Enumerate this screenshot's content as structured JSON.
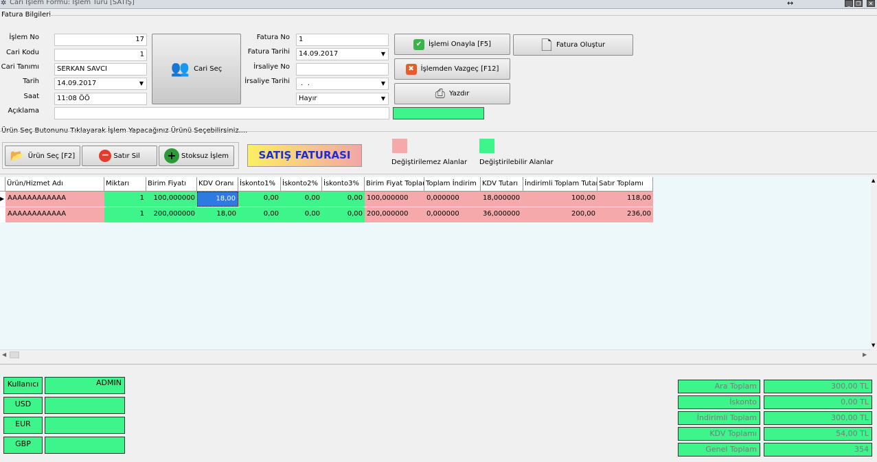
{
  "window": {
    "title": "Cari İşlem Formu: İşlem Türü [SATIŞ]"
  },
  "section": {
    "title": "Fatura Bilgileri",
    "hint": "Ürün Seç Butonunu Tıklayarak İşlem Yapacağınız Ürünü Seçebilirsiniz...."
  },
  "left_form": {
    "islem_no": {
      "label": "İşlem No",
      "value": "17"
    },
    "cari_kodu": {
      "label": "Cari Kodu",
      "value": "1"
    },
    "cari_tanimi": {
      "label": "Cari Tanımı",
      "value": "SERKAN SAVCI"
    },
    "tarih": {
      "label": "Tarih",
      "value": "14.09.2017"
    },
    "saat": {
      "label": "Saat",
      "value": "11:08 ÖÖ"
    },
    "aciklama": {
      "label": "Açıklama",
      "value": ""
    }
  },
  "cari_sec_button": "Cari Seç",
  "mid_form": {
    "fatura_no": {
      "label": "Fatura No",
      "value": "1"
    },
    "fatura_tarihi": {
      "label": "Fatura Tarihi",
      "value": "14.09.2017"
    },
    "irsaliye_no": {
      "label": "İrsaliye No",
      "value": ""
    },
    "irsaliye_tarihi": {
      "label": "İrsaliye Tarihi",
      "value": " .  ."
    },
    "combo": {
      "value": "Hayır"
    }
  },
  "actions": {
    "onayla": "İşlemi Onayla  [F5]",
    "vazgec": "İşlemden Vazgeç  [F12]",
    "yazdir": "Yazdır",
    "fatura_olustur": "Fatura Oluştur"
  },
  "toolbar": {
    "urun_sec": "Ürün Seç  [F2]",
    "satir_sil": "Satır Sil",
    "stoksuz": "Stoksuz İşlem",
    "banner": "SATIŞ FATURASI"
  },
  "legend": {
    "non_editable": "Değiştirilemez Alanlar",
    "editable": "Değiştirilebilir Alanlar"
  },
  "colors": {
    "editable": "#3ef58c",
    "non_editable": "#f6a9ab",
    "banner_bg": "#f9e95a",
    "banner_text": "#1a2fd6"
  },
  "grid": {
    "columns": [
      "Ürün/Hizmet Adı",
      "Miktarı",
      "Birim Fiyatı",
      "KDV Oranı",
      "İskonto1%",
      "İskonto2%",
      "İskonto3%",
      "Birim Fiyat Toplam",
      "Toplam İndirim",
      "KDV Tutarı",
      "İndirimli Toplam Tutar",
      "Satır Toplamı"
    ],
    "rows": [
      [
        "AAAAAAAAAAAA",
        "1",
        "100,000000",
        "18,00",
        "0,00",
        "0,00",
        "0,00",
        "100,000000",
        "0,000000",
        "18,000000",
        "100,00",
        "118,00"
      ],
      [
        "AAAAAAAAAAAA",
        "1",
        "200,000000",
        "18,00",
        "0,00",
        "0,00",
        "0,00",
        "200,000000",
        "0,000000",
        "36,000000",
        "200,00",
        "236,00"
      ]
    ]
  },
  "user_panel": [
    {
      "label": "Kullanıcı",
      "value": "ADMIN"
    },
    {
      "label": "USD",
      "value": ""
    },
    {
      "label": "EUR",
      "value": ""
    },
    {
      "label": "GBP",
      "value": ""
    }
  ],
  "totals": [
    {
      "label": "Ara Toplam",
      "value": "300,00 TL"
    },
    {
      "label": "İskonto",
      "value": "0,00 TL"
    },
    {
      "label": "İndirimli Toplam",
      "value": "300,00 TL"
    },
    {
      "label": "KDV Toplamı",
      "value": "54,00 TL"
    },
    {
      "label": "Genel Toplam",
      "value": "354"
    }
  ]
}
